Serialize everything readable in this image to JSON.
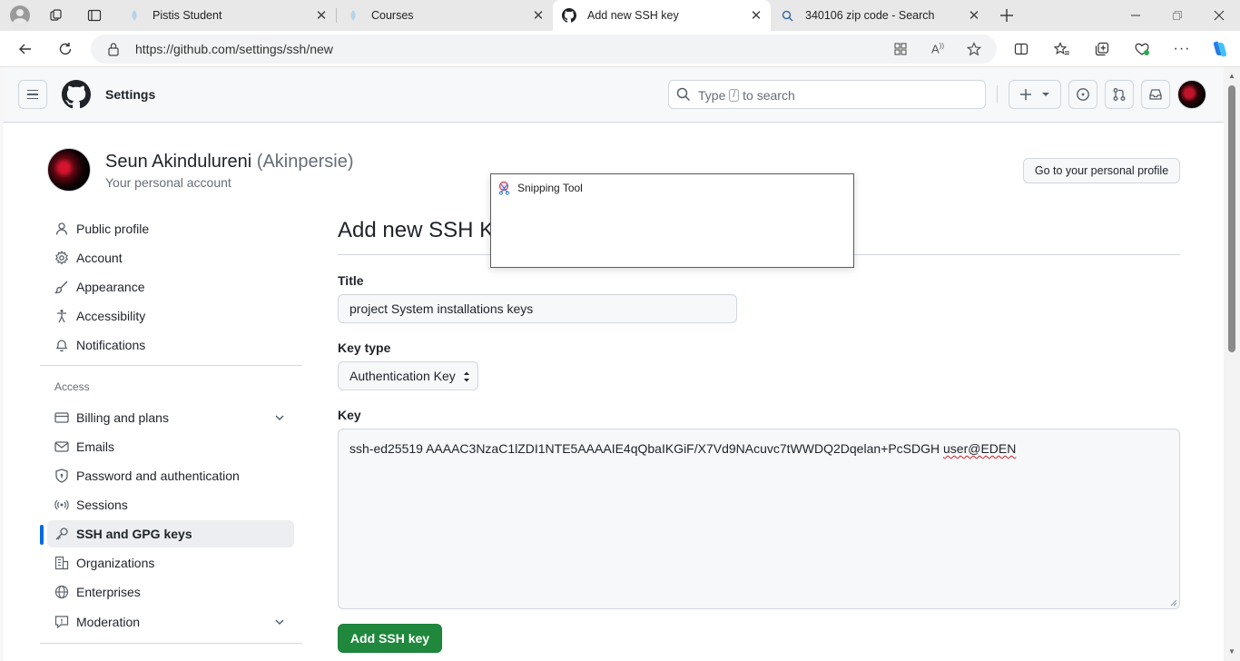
{
  "browser": {
    "tabs": [
      {
        "title": "Pistis Student",
        "favicon": "pistis-icon"
      },
      {
        "title": "Courses",
        "favicon": "pistis-icon"
      },
      {
        "title": "Add new SSH key",
        "favicon": "github-icon"
      },
      {
        "title": "340106 zip code - Search",
        "favicon": "search-icon"
      }
    ],
    "url": "https://github.com/settings/ssh/new"
  },
  "header": {
    "context": "Settings",
    "search_prefix": "Type",
    "search_key": "/",
    "search_suffix": "to search"
  },
  "profile": {
    "name": "Seun Akindulureni",
    "login": "(Akinpersie)",
    "subtitle": "Your personal account",
    "go_profile": "Go to your personal profile"
  },
  "sidebar": {
    "items": [
      {
        "label": "Public profile",
        "icon": "person-icon"
      },
      {
        "label": "Account",
        "icon": "gear-icon"
      },
      {
        "label": "Appearance",
        "icon": "paintbrush-icon"
      },
      {
        "label": "Accessibility",
        "icon": "accessibility-icon"
      },
      {
        "label": "Notifications",
        "icon": "bell-icon"
      }
    ],
    "access_heading": "Access",
    "access_items": [
      {
        "label": "Billing and plans",
        "icon": "credit-card-icon"
      },
      {
        "label": "Emails",
        "icon": "mail-icon"
      },
      {
        "label": "Password and authentication",
        "icon": "shield-lock-icon"
      },
      {
        "label": "Sessions",
        "icon": "broadcast-icon"
      },
      {
        "label": "SSH and GPG keys",
        "icon": "key-icon"
      },
      {
        "label": "Organizations",
        "icon": "organization-icon"
      },
      {
        "label": "Enterprises",
        "icon": "globe-icon"
      },
      {
        "label": "Moderation",
        "icon": "report-icon"
      }
    ]
  },
  "form": {
    "heading": "Add new SSH Key",
    "title_label": "Title",
    "title_value": "project System installations keys",
    "keytype_label": "Key type",
    "keytype_value": "Authentication Key",
    "key_label": "Key",
    "key_value_main": "ssh-ed25519 AAAAC3NzaC1lZDI1NTE5AAAAIE4qQbaIKGiF/X7Vd9NAcuvc7tWWDQ2Dqelan+PcSDGH ",
    "key_value_flagged": "user@EDEN",
    "submit": "Add SSH key"
  },
  "popup": {
    "title": "Snipping Tool"
  },
  "colors": {
    "primary_button": "#1f883d",
    "selected_indicator": "#0969da",
    "browser_accent": "#0f6cbd"
  }
}
